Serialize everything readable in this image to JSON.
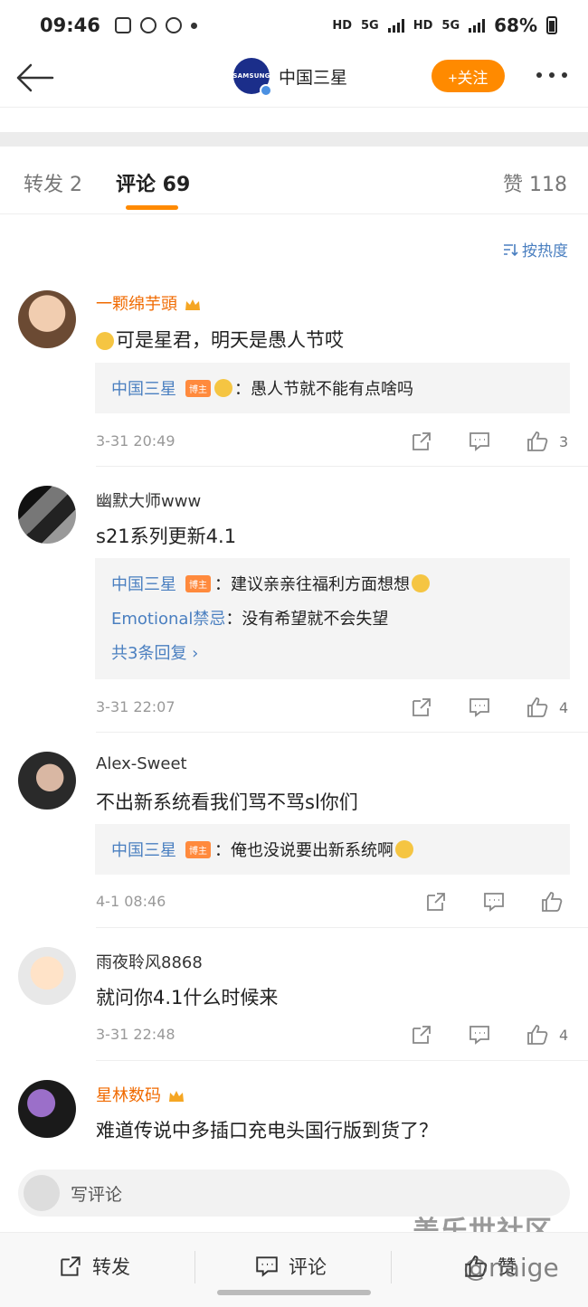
{
  "status": {
    "time": "09:46",
    "net1": "HD",
    "net2": "5G",
    "net3": "HD",
    "net4": "5G",
    "battery": "68%"
  },
  "header": {
    "account_name": "中国三星",
    "logo_text": "SAMSUNG",
    "follow_label": "+关注"
  },
  "tabs": [
    {
      "label": "转发 2"
    },
    {
      "label": "评论 69"
    },
    {
      "label": "赞 118"
    }
  ],
  "sort_label": "按热度",
  "comments": [
    {
      "user": "一颗绵芋頭",
      "text": "可是星君，明天是愚人节哎",
      "replies": [
        {
          "name": "中国三星",
          "badge": "博主",
          "text": "：愚人节就不能有点啥吗"
        }
      ],
      "time": "3-31 20:49",
      "likes": "3"
    },
    {
      "user": "幽默大师www",
      "text": "s21系列更新4.1",
      "replies": [
        {
          "name": "中国三星",
          "badge": "博主",
          "text": "：建议亲亲往福利方面想想"
        },
        {
          "name": "Emotional禁忌",
          "badge": "",
          "text": "：没有希望就不会失望"
        }
      ],
      "more_replies": "共3条回复 ›",
      "time": "3-31 22:07",
      "likes": "4"
    },
    {
      "user": "Alex-Sweet",
      "text": "不出新系统看我们骂不骂sl你们",
      "replies": [
        {
          "name": "中国三星",
          "badge": "博主",
          "text": "：俺也没说要出新系统啊"
        }
      ],
      "time": "4-1 08:46",
      "likes": ""
    },
    {
      "user": "雨夜聆风8868",
      "text": "就问你4.1什么时候来",
      "time": "3-31 22:48",
      "likes": "4"
    },
    {
      "user": "星林数码",
      "text": "难道传说中多插口充电头国行版到货了？"
    }
  ],
  "input_placeholder": "写评论",
  "bottom": {
    "repost": "转发",
    "comment": "评论",
    "like": "赞"
  },
  "watermark": {
    "line1": "盖乐世社区",
    "line2": "@naige"
  },
  "colors": {
    "accent": "#ff8a00",
    "link": "#4a7fc0",
    "vip_name": "#f06a00"
  }
}
